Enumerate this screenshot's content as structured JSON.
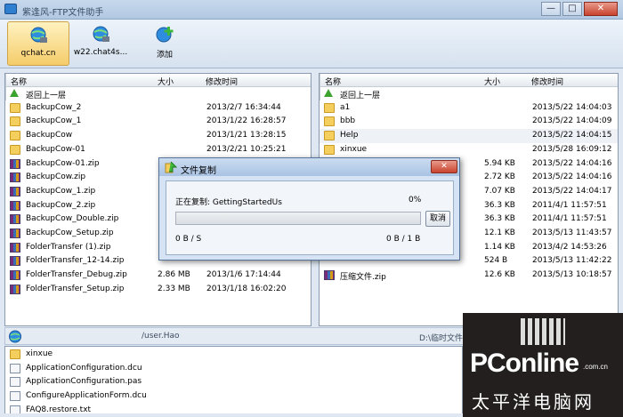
{
  "window": {
    "title": "紫逢风-FTP文件助手",
    "minimize": "—",
    "maximize": "□",
    "close": "✕"
  },
  "toolbar": {
    "items": [
      {
        "label": "qchat.cn",
        "icon": "globe-connection-icon",
        "active": true
      },
      {
        "label": "w22.chat4s...",
        "icon": "globe-connection-icon",
        "active": false
      },
      {
        "label": "添加",
        "icon": "add-site-icon",
        "active": false
      }
    ]
  },
  "columns": {
    "name": "名称",
    "size": "大小",
    "modified": "修改时间"
  },
  "left_panel": {
    "rows": [
      {
        "name": "返回上一层",
        "size": "",
        "modified": "",
        "icon": "up-arrow-icon"
      },
      {
        "name": "BackupCow_2",
        "size": "",
        "modified": "2013/2/7 16:34:44",
        "icon": "folder-icon"
      },
      {
        "name": "BackupCow_1",
        "size": "",
        "modified": "2013/1/22 16:28:57",
        "icon": "folder-icon"
      },
      {
        "name": "BackupCow",
        "size": "",
        "modified": "2013/1/21 13:28:15",
        "icon": "folder-icon"
      },
      {
        "name": "BackupCow-01",
        "size": "",
        "modified": "2013/2/21 10:25:21",
        "icon": "folder-icon"
      },
      {
        "name": "BackupCow-01.zip",
        "size": "",
        "modified": "",
        "icon": "zip-icon"
      },
      {
        "name": "BackupCow.zip",
        "size": "",
        "modified": "",
        "icon": "zip-icon"
      },
      {
        "name": "BackupCow_1.zip",
        "size": "",
        "modified": "",
        "icon": "zip-icon"
      },
      {
        "name": "BackupCow_2.zip",
        "size": "",
        "modified": "",
        "icon": "zip-icon"
      },
      {
        "name": "BackupCow_Double.zip",
        "size": "",
        "modified": "",
        "icon": "zip-icon"
      },
      {
        "name": "BackupCow_Setup.zip",
        "size": "",
        "modified": "",
        "icon": "zip-icon"
      },
      {
        "name": "FolderTransfer (1).zip",
        "size": "",
        "modified": "",
        "icon": "zip-icon"
      },
      {
        "name": "FolderTransfer_12-14.zip",
        "size": "",
        "modified": "",
        "icon": "zip-icon"
      },
      {
        "name": "FolderTransfer_Debug.zip",
        "size": "2.86 MB",
        "modified": "2013/1/6 17:14:44",
        "icon": "zip-icon"
      },
      {
        "name": "FolderTransfer_Setup.zip",
        "size": "2.33 MB",
        "modified": "2013/1/18 16:02:20",
        "icon": "zip-icon"
      }
    ]
  },
  "right_panel": {
    "rows": [
      {
        "name": "返回上一层",
        "size": "",
        "modified": "",
        "icon": "up-arrow-icon"
      },
      {
        "name": "a1",
        "size": "",
        "modified": "2013/5/22 14:04:03",
        "icon": "folder-icon"
      },
      {
        "name": "bbb",
        "size": "",
        "modified": "2013/5/22 14:04:09",
        "icon": "folder-icon"
      },
      {
        "name": "Help",
        "size": "",
        "modified": "2013/5/22 14:04:15",
        "icon": "folder-icon"
      },
      {
        "name": "xinxue",
        "size": "",
        "modified": "2013/5/28 16:09:12",
        "icon": "folder-icon"
      },
      {
        "name": "",
        "size": "5.94 KB",
        "modified": "2013/5/22 14:04:16",
        "icon": ""
      },
      {
        "name": "",
        "size": "2.72 KB",
        "modified": "2013/5/22 14:04:16",
        "icon": ""
      },
      {
        "name": "",
        "size": "7.07 KB",
        "modified": "2013/5/22 14:04:17",
        "icon": ""
      },
      {
        "name": "",
        "size": "36.3 KB",
        "modified": "2011/4/1 11:57:51",
        "icon": ""
      },
      {
        "name": "",
        "size": "36.3 KB",
        "modified": "2011/4/1 11:57:51",
        "icon": ""
      },
      {
        "name": "",
        "size": "12.1 KB",
        "modified": "2013/5/13 11:43:57",
        "icon": ""
      },
      {
        "name": "",
        "size": "1.14 KB",
        "modified": "2013/4/2 14:53:26",
        "icon": ""
      },
      {
        "name": "",
        "size": "524 B",
        "modified": "2013/5/13 11:42:22",
        "icon": ""
      },
      {
        "name": "压缩文件.zip",
        "size": "12.6 KB",
        "modified": "2013/5/13 10:18:57",
        "icon": "zip-icon"
      }
    ]
  },
  "status": {
    "remote_path": "/user.Hao",
    "local_path": "D:\\临时文件夹\\aaa"
  },
  "bottom_panel": {
    "rows": [
      {
        "name": "xinxue",
        "icon": "folder-icon"
      },
      {
        "name": "ApplicationConfiguration.dcu",
        "icon": "file-icon"
      },
      {
        "name": "ApplicationConfiguration.pas",
        "icon": "file-icon"
      },
      {
        "name": "ConfigureApplicationForm.dcu",
        "icon": "file-icon"
      },
      {
        "name": "FAQ8.restore.txt",
        "icon": "file-icon"
      }
    ]
  },
  "dialog": {
    "title": "文件复制",
    "copying_label": "正在复制: GettingStartedUs",
    "percent": "0%",
    "progress": 0,
    "cancel": "取消",
    "speed": "0 B / S",
    "transferred": "0 B / 1 B"
  },
  "watermark": {
    "brand": "PConline",
    "domain": ".com.cn",
    "chinese": "太平洋电脑网"
  }
}
